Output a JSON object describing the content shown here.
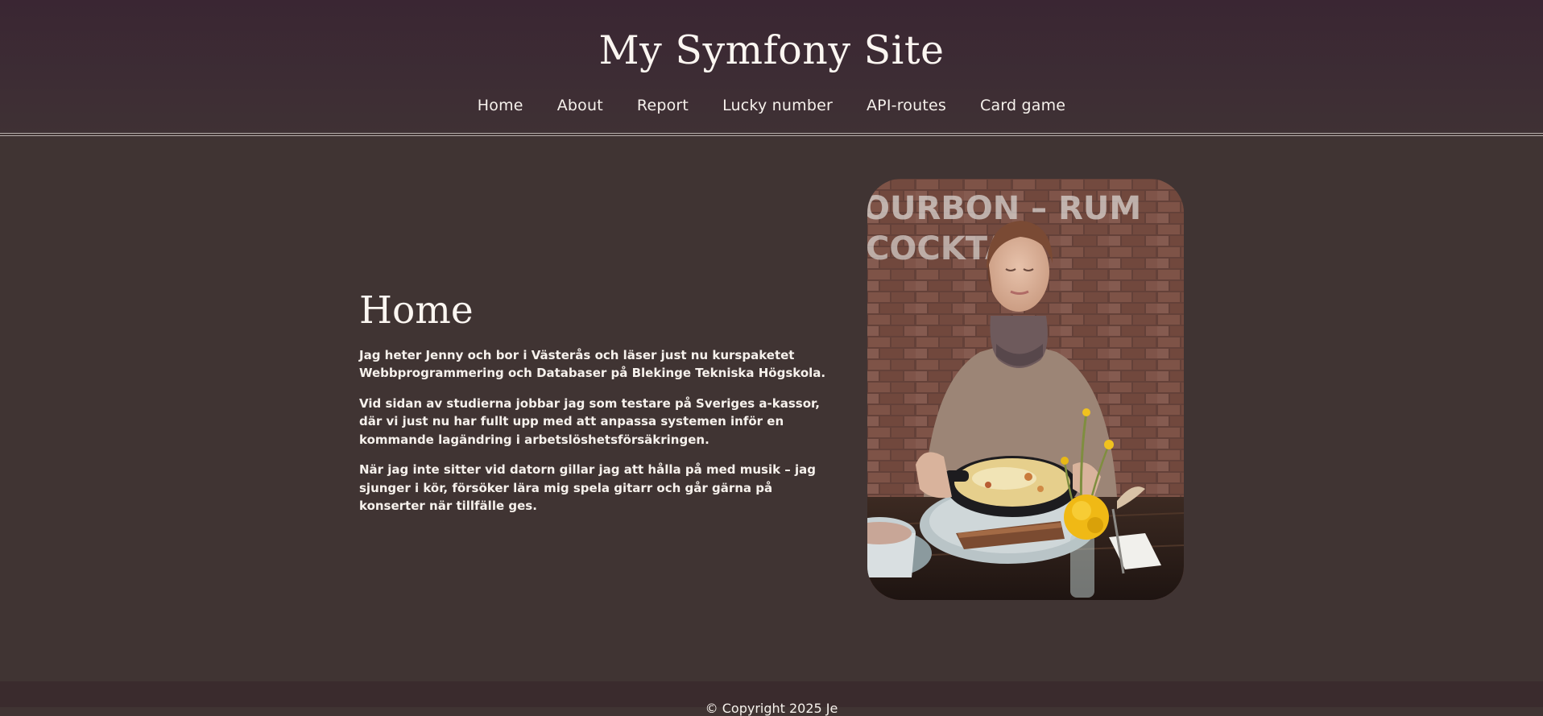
{
  "header": {
    "site_title": "My Symfony Site"
  },
  "nav": {
    "items": [
      {
        "label": "Home"
      },
      {
        "label": "About"
      },
      {
        "label": "Report"
      },
      {
        "label": "Lucky number"
      },
      {
        "label": "API-routes"
      },
      {
        "label": "Card game"
      }
    ]
  },
  "main": {
    "heading": "Home",
    "paragraphs": [
      "Jag heter Jenny och bor i Västerås och läser just nu kurspaketet Webbprogrammering och Databaser på Blekinge Tekniska Högskola.",
      "Vid sidan av studierna jobbar jag som testare på Sveriges a-kassor, där vi just nu har fullt upp med att anpassa systemen inför en kommande lagändring i arbetslöshetsförsäkringen.",
      "När jag inte sitter vid datorn gillar jag att hålla på med musik – jag sjunger i kör, försöker lära mig spela gitarr och går gärna på konserter när tillfälle ges."
    ],
    "photo": {
      "wall_text_line1": "OURBON – RUM",
      "wall_text_line2": "COCKTA"
    }
  },
  "footer": {
    "text": "© Copyright 2025 Je"
  },
  "colors": {
    "background": "#403433",
    "header_top": "#3a2633",
    "text": "#f4efe9"
  }
}
